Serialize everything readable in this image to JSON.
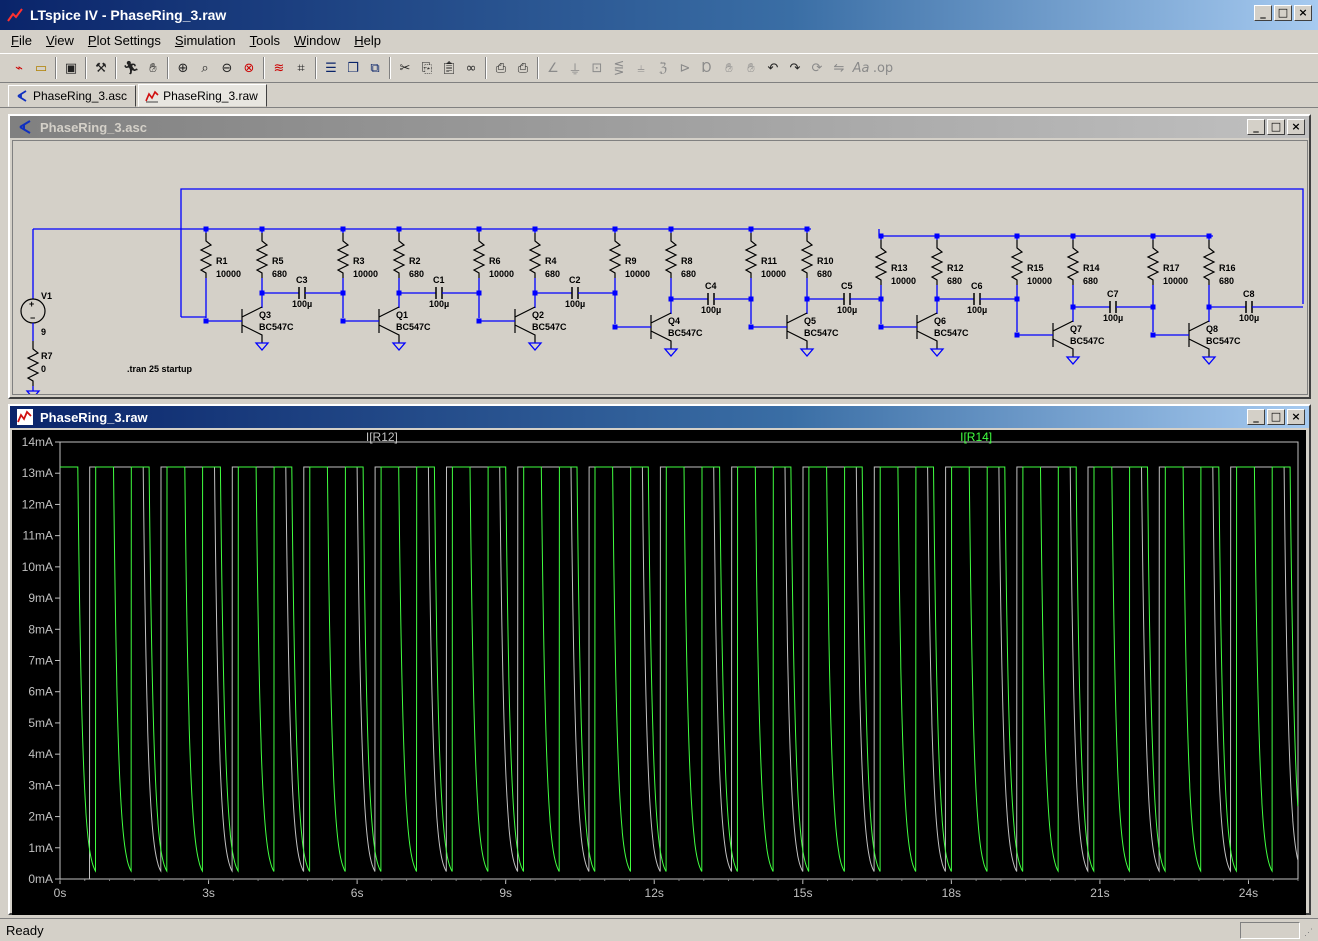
{
  "app": {
    "title": "LTspice IV - PhaseRing_3.raw",
    "window_buttons": [
      "_",
      "□",
      "×"
    ]
  },
  "menu": [
    {
      "label": "File",
      "u": "F",
      "rest": "ile"
    },
    {
      "label": "View",
      "u": "V",
      "rest": "iew"
    },
    {
      "label": "Plot Settings",
      "u": "P",
      "rest": "lot Settings"
    },
    {
      "label": "Simulation",
      "u": "S",
      "rest": "imulation"
    },
    {
      "label": "Tools",
      "u": "T",
      "rest": "ools"
    },
    {
      "label": "Window",
      "u": "W",
      "rest": "indow"
    },
    {
      "label": "Help",
      "u": "H",
      "rest": "elp"
    }
  ],
  "toolbar_icons": [
    "new-schematic-icon",
    "open-icon",
    "save-icon",
    "control-panel-icon",
    "run-icon",
    "halt-icon",
    "zoom-in-icon",
    "zoom-out-icon",
    "zoom-pan-icon",
    "zoom-cancel-icon",
    "autorange-icon",
    "zoom-fit-icon",
    "tile-horizontal-icon",
    "cascade-icon",
    "close-all-icon",
    "cut-icon",
    "copy-icon",
    "paste-icon",
    "find-icon",
    "print-preview-icon",
    "print-icon",
    "wire-icon",
    "ground-icon",
    "label-net-icon",
    "resistor-icon",
    "capacitor-icon",
    "inductor-icon",
    "diode-icon",
    "component-icon",
    "move-icon",
    "drag-icon",
    "undo-icon",
    "redo-icon",
    "rotate-icon",
    "mirror-icon",
    "text-icon",
    "spice-directive-icon"
  ],
  "tabs": [
    {
      "label": "PhaseRing_3.asc",
      "kind": "schematic"
    },
    {
      "label": "PhaseRing_3.raw",
      "kind": "waveform"
    }
  ],
  "schematic_window": {
    "title": "PhaseRing_3.asc",
    "directive": ".tran 25 startup",
    "source": {
      "name": "V1",
      "value": "9",
      "series_resistor": "R7",
      "series_value": "0"
    },
    "stages": [
      {
        "rb": "R1",
        "rb_val": "10000",
        "rc": "R5",
        "rc_val": "680",
        "cap": "C3",
        "cap_val": "100µ",
        "q": "Q3",
        "model": "BC547C"
      },
      {
        "rb": "R3",
        "rb_val": "10000",
        "rc": "R2",
        "rc_val": "680",
        "cap": "C1",
        "cap_val": "100µ",
        "q": "Q1",
        "model": "BC547C"
      },
      {
        "rb": "R6",
        "rb_val": "10000",
        "rc": "R4",
        "rc_val": "680",
        "cap": "C2",
        "cap_val": "100µ",
        "q": "Q2",
        "model": "BC547C"
      },
      {
        "rb": "R9",
        "rb_val": "10000",
        "rc": "R8",
        "rc_val": "680",
        "cap": "C4",
        "cap_val": "100µ",
        "q": "Q4",
        "model": "BC547C"
      },
      {
        "rb": "R11",
        "rb_val": "10000",
        "rc": "R10",
        "rc_val": "680",
        "cap": "C5",
        "cap_val": "100µ",
        "q": "Q5",
        "model": "BC547C"
      },
      {
        "rb": "R13",
        "rb_val": "10000",
        "rc": "R12",
        "rc_val": "680",
        "cap": "C6",
        "cap_val": "100µ",
        "q": "Q6",
        "model": "BC547C"
      },
      {
        "rb": "R15",
        "rb_val": "10000",
        "rc": "R14",
        "rc_val": "680",
        "cap": "C7",
        "cap_val": "100µ",
        "q": "Q7",
        "model": "BC547C"
      },
      {
        "rb": "R17",
        "rb_val": "10000",
        "rc": "R16",
        "rc_val": "680",
        "cap": "C8",
        "cap_val": "100µ",
        "q": "Q8",
        "model": "BC547C"
      }
    ]
  },
  "waveform_window": {
    "title": "PhaseRing_3.raw"
  },
  "chart_data": {
    "type": "line",
    "title": "",
    "xlabel": "",
    "ylabel": "",
    "xlim": [
      0,
      25
    ],
    "ylim": [
      0,
      14
    ],
    "x_ticks": [
      "0s",
      "3s",
      "6s",
      "9s",
      "12s",
      "15s",
      "18s",
      "21s",
      "24s"
    ],
    "y_ticks": [
      "0mA",
      "1mA",
      "2mA",
      "3mA",
      "4mA",
      "5mA",
      "6mA",
      "7mA",
      "8mA",
      "9mA",
      "10mA",
      "11mA",
      "12mA",
      "13mA",
      "14mA"
    ],
    "grid": false,
    "legend_placement": "top",
    "series": [
      {
        "name": "I[R12]",
        "color": "#c0c0c0",
        "start_s": 0.6,
        "period_s": 1.44,
        "plateau_mA": 13.2,
        "on_fraction": 0.75
      },
      {
        "name": "I[R14]",
        "color": "#40ff40",
        "start_s": 0.0,
        "period_s": 0.72,
        "plateau_mA": 13.2,
        "on_fraction": 0.5
      }
    ]
  },
  "status": {
    "text": "Ready"
  }
}
